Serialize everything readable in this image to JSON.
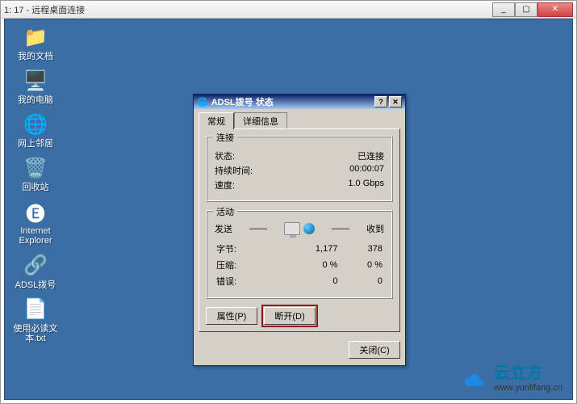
{
  "outer": {
    "title": "1:        17 - 远程桌面连接"
  },
  "desktop_icons": [
    {
      "name": "my-documents",
      "label": "我的文档",
      "glyph": "📁"
    },
    {
      "name": "my-computer",
      "label": "我的电脑",
      "glyph": "🖥️"
    },
    {
      "name": "network-places",
      "label": "网上邻居",
      "glyph": "🌐"
    },
    {
      "name": "recycle-bin",
      "label": "回收站",
      "glyph": "🗑️"
    },
    {
      "name": "internet-explorer",
      "label": "Internet Explorer",
      "glyph": "🅔"
    },
    {
      "name": "adsl-dial",
      "label": "ADSL拨号",
      "glyph": "🔗"
    },
    {
      "name": "readme-txt",
      "label": "使用必读文本.txt",
      "glyph": "📄"
    }
  ],
  "dialog": {
    "title": "ADSL拨号 状态",
    "tabs": {
      "general": "常规",
      "details": "详细信息"
    },
    "conn_group": "连接",
    "conn": {
      "status_label": "状态:",
      "status_value": "已连接",
      "duration_label": "持续时间:",
      "duration_value": "00:00:07",
      "speed_label": "速度:",
      "speed_value": "1.0 Gbps"
    },
    "act_group": "活动",
    "act_head": {
      "sent": "发送",
      "dash": "——",
      "recv": "收到"
    },
    "act_rows": {
      "bytes_label": "字节:",
      "bytes_sent": "1,177",
      "bytes_recv": "378",
      "comp_label": "压缩:",
      "comp_sent": "0 %",
      "comp_recv": "0 %",
      "err_label": "错误:",
      "err_sent": "0",
      "err_recv": "0"
    },
    "buttons": {
      "properties": "属性(P)",
      "disconnect": "断开(D)",
      "close": "关闭(C)"
    }
  },
  "watermark": {
    "brand": "云立方",
    "url": "www.yunlifang.cn"
  }
}
